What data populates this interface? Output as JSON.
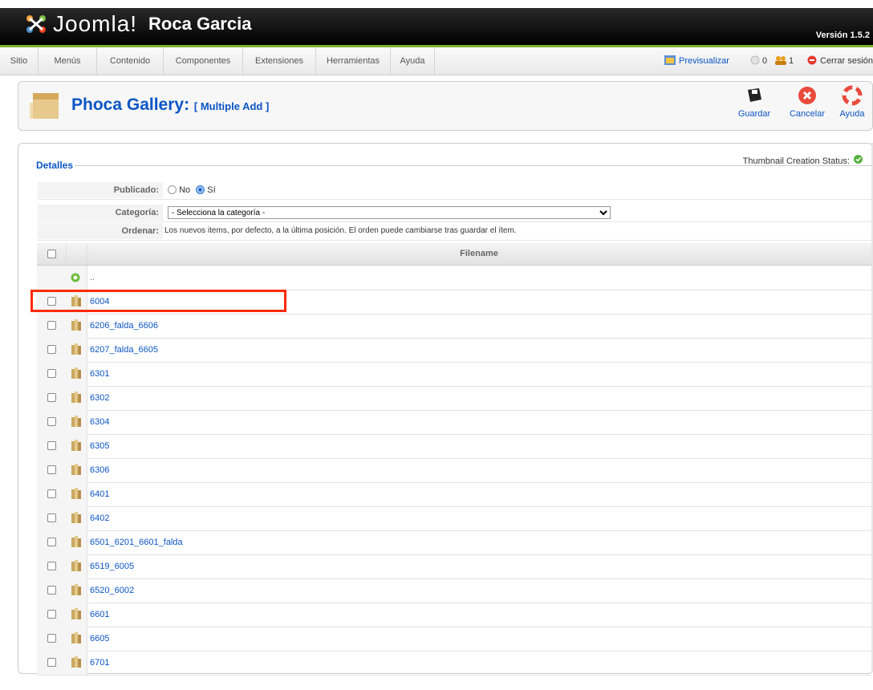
{
  "header": {
    "logo_text": "Joomla!",
    "site_name": "Roca Garcia",
    "version": "Versión 1.5.2"
  },
  "menu": {
    "items": [
      "Sitio",
      "Menús",
      "Contenido",
      "Componentes",
      "Extensiones",
      "Herramientas",
      "Ayuda"
    ],
    "preview": "Previsualizar",
    "messages_count": "0",
    "users_count": "1",
    "logout": "Cerrar sesión"
  },
  "toolbar": {
    "title": "Phoca Gallery:",
    "subtitle": "[ Multiple Add ]",
    "save": "Guardar",
    "cancel": "Cancelar",
    "help": "Ayuda"
  },
  "status": {
    "thumbnail_label": "Thumbnail Creation Status:"
  },
  "details": {
    "legend": "Detalles",
    "published_label": "Publicado:",
    "published_no": "No",
    "published_yes": "Sí",
    "published_value": "Sí",
    "category_label": "Categoría:",
    "category_value": "- Selecciona la categoría -",
    "order_label": "Ordenar:",
    "order_text": "Los nuevos items, por defecto, a la última posición. El orden puede cambiarse tras guardar el ítem."
  },
  "table": {
    "column_header": "Filename",
    "parent_row": "..",
    "files": [
      "6004",
      "6206_falda_6606",
      "6207_falda_6605",
      "6301",
      "6302",
      "6304",
      "6305",
      "6306",
      "6401",
      "6402",
      "6501_6201_6601_falda",
      "6519_6005",
      "6520_6002",
      "6601",
      "6605",
      "6701"
    ]
  },
  "colors": {
    "link": "#0b55c4",
    "accent_green": "#7ab02c",
    "highlight": "#ff2a00"
  }
}
